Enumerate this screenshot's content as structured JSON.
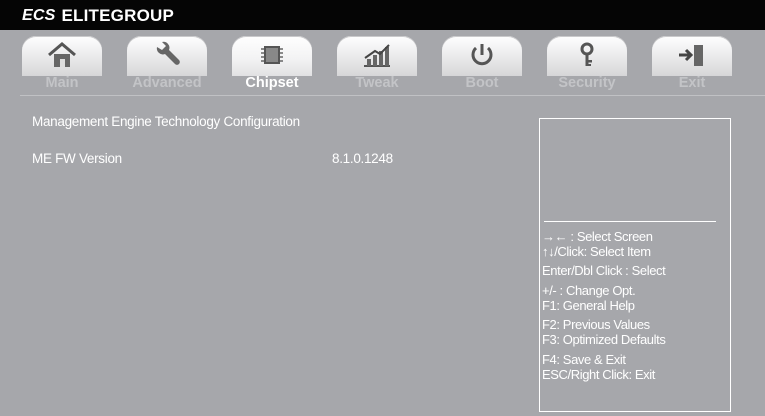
{
  "header": {
    "logo": "ECS",
    "brand": "ELITEGROUP"
  },
  "tabs": [
    {
      "label": "Main",
      "icon": "home-icon",
      "active": false
    },
    {
      "label": "Advanced",
      "icon": "wrench-icon",
      "active": false
    },
    {
      "label": "Chipset",
      "icon": "chip-icon",
      "active": true
    },
    {
      "label": "Tweak",
      "icon": "chart-icon",
      "active": false
    },
    {
      "label": "Boot",
      "icon": "power-icon",
      "active": false
    },
    {
      "label": "Security",
      "icon": "key-icon",
      "active": false
    },
    {
      "label": "Exit",
      "icon": "exit-icon",
      "active": false
    }
  ],
  "main": {
    "title": "Management Engine Technology Configuration",
    "rows": [
      {
        "label": "ME FW Version",
        "value": "8.1.0.1248"
      }
    ]
  },
  "help": {
    "lines": [
      "→← : Select Screen",
      "↑↓/Click: Select Item",
      "Enter/Dbl Click : Select",
      "+/- : Change Opt.",
      "F1: General Help",
      "F2: Previous Values",
      "F3: Optimized Defaults",
      "F4: Save & Exit",
      "ESC/Right Click: Exit"
    ]
  },
  "colors": {
    "background": "#a6a7ab",
    "topbar": "#050505",
    "text": "#ffffff",
    "tab_inactive": "#c3c4c7"
  }
}
